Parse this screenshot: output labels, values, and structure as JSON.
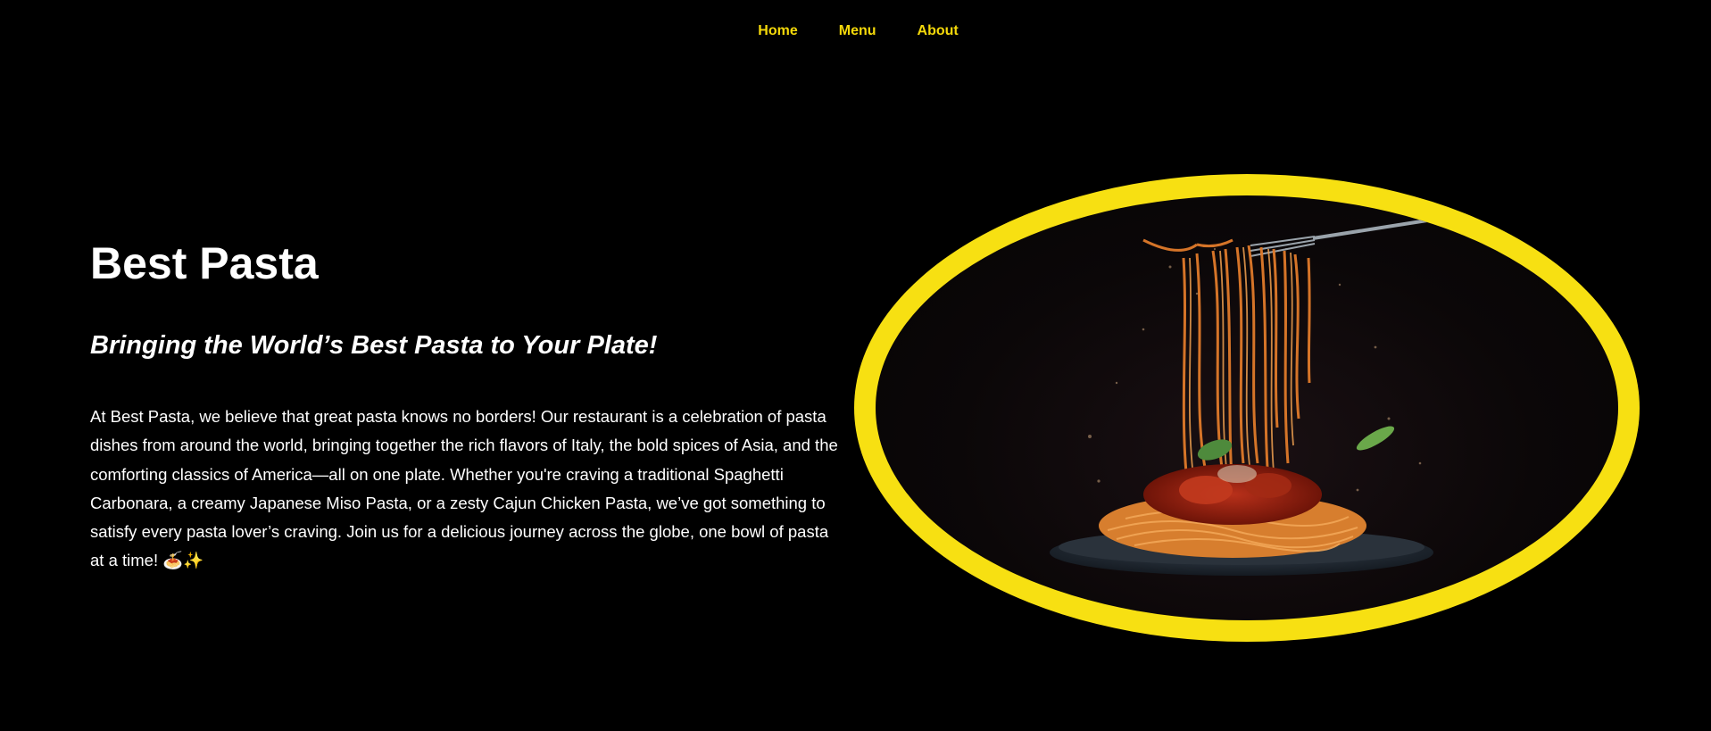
{
  "nav": {
    "items": [
      {
        "label": "Home"
      },
      {
        "label": "Menu"
      },
      {
        "label": "About"
      }
    ]
  },
  "hero": {
    "title": "Best Pasta",
    "tagline": "Bringing the World’s Best Pasta to Your Plate!",
    "body": "At Best Pasta, we believe that great pasta knows no borders! Our restaurant is a celebration of pasta dishes from around the world, bringing together the rich flavors of Italy, the bold spices of Asia, and the comforting classics of America—all on one plate. Whether you're craving a traditional Spaghetti Carbonara, a creamy Japanese Miso Pasta, or a zesty Cajun Chicken Pasta, we’ve got something to satisfy every pasta lover’s craving. Join us for a delicious journey across the globe, one bowl of pasta at a time! 🍝✨"
  },
  "colors": {
    "background": "#000000",
    "nav_link": "#f5d90a",
    "image_frame": "#f7e012",
    "text": "#ffffff"
  }
}
